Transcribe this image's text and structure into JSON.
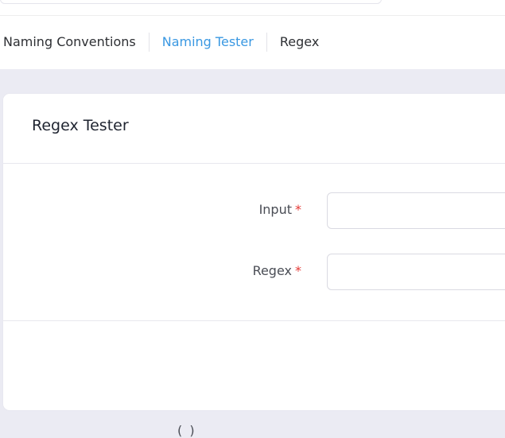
{
  "tabs": [
    {
      "label": "Naming Conventions",
      "active": false
    },
    {
      "label": "Naming Tester",
      "active": true
    },
    {
      "label": "Regex",
      "active": false
    }
  ],
  "colors": {
    "accent": "#3a98e2",
    "required": "#e53935",
    "page_bg": "#ebebf3"
  },
  "card": {
    "title": "Regex Tester"
  },
  "form": {
    "input_label": "Input",
    "regex_label": "Regex",
    "required_mark": "*",
    "input_value": "",
    "regex_value": ""
  },
  "footer_fragment": "( )"
}
